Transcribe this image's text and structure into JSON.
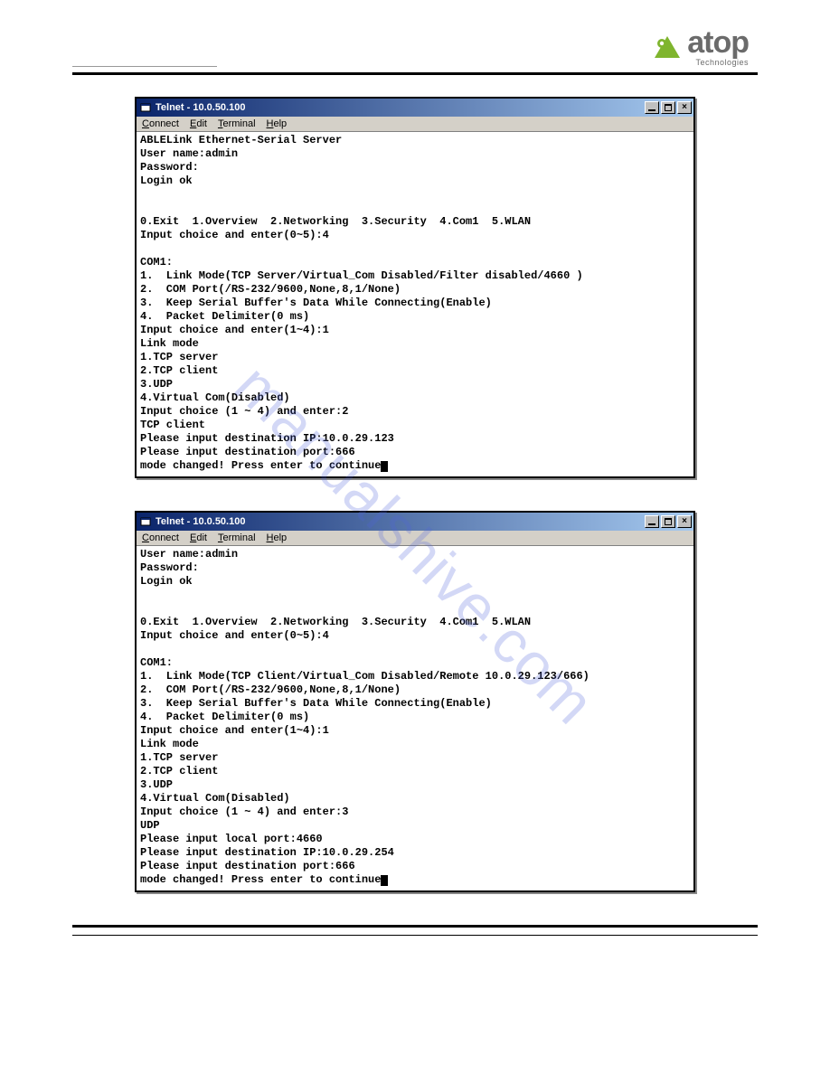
{
  "logo": {
    "word": "atop",
    "sub": "Technologies"
  },
  "watermark": "manualshive.com",
  "menu": {
    "connect": "Connect",
    "edit": "Edit",
    "terminal": "Terminal",
    "help": "Help"
  },
  "window1": {
    "title": "Telnet - 10.0.50.100",
    "lines": [
      "ABLELink Ethernet-Serial Server",
      "User name:admin",
      "Password:",
      "Login ok",
      "",
      "",
      "0.Exit  1.Overview  2.Networking  3.Security  4.Com1  5.WLAN",
      "Input choice and enter(0~5):4",
      "",
      "COM1:",
      "1.  Link Mode(TCP Server/Virtual_Com Disabled/Filter disabled/4660 )",
      "2.  COM Port(/RS-232/9600,None,8,1/None)",
      "3.  Keep Serial Buffer's Data While Connecting(Enable)",
      "4.  Packet Delimiter(0 ms)",
      "Input choice and enter(1~4):1",
      "Link mode",
      "1.TCP server",
      "2.TCP client",
      "3.UDP",
      "4.Virtual Com(Disabled)",
      "Input choice (1 ~ 4) and enter:2",
      "TCP client",
      "Please input destination IP:10.0.29.123",
      "Please input destination port:666",
      "mode changed! Press enter to continue"
    ]
  },
  "window2": {
    "title": "Telnet - 10.0.50.100",
    "lines": [
      "User name:admin",
      "Password:",
      "Login ok",
      "",
      "",
      "0.Exit  1.Overview  2.Networking  3.Security  4.Com1  5.WLAN",
      "Input choice and enter(0~5):4",
      "",
      "COM1:",
      "1.  Link Mode(TCP Client/Virtual_Com Disabled/Remote 10.0.29.123/666)",
      "2.  COM Port(/RS-232/9600,None,8,1/None)",
      "3.  Keep Serial Buffer's Data While Connecting(Enable)",
      "4.  Packet Delimiter(0 ms)",
      "Input choice and enter(1~4):1",
      "Link mode",
      "1.TCP server",
      "2.TCP client",
      "3.UDP",
      "4.Virtual Com(Disabled)",
      "Input choice (1 ~ 4) and enter:3",
      "UDP",
      "Please input local port:4660",
      "Please input destination IP:10.0.29.254",
      "Please input destination port:666",
      "mode changed! Press enter to continue"
    ]
  }
}
